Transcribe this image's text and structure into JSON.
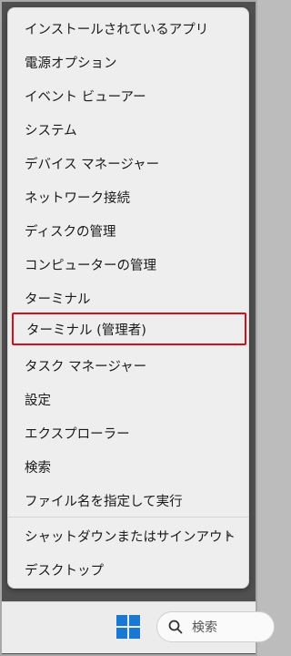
{
  "menu": {
    "items": [
      {
        "label": "インストールされているアプリ"
      },
      {
        "label": "電源オプション"
      },
      {
        "label": "イベント ビューアー"
      },
      {
        "label": "システム"
      },
      {
        "label": "デバイス マネージャー"
      },
      {
        "label": "ネットワーク接続"
      },
      {
        "label": "ディスクの管理"
      },
      {
        "label": "コンピューターの管理"
      },
      {
        "label": "ターミナル"
      },
      {
        "label": "ターミナル (管理者)"
      },
      {
        "label": "タスク マネージャー"
      },
      {
        "label": "設定"
      },
      {
        "label": "エクスプローラー"
      },
      {
        "label": "検索"
      },
      {
        "label": "ファイル名を指定して実行"
      },
      {
        "label": "シャットダウンまたはサインアウト"
      },
      {
        "label": "デスクトップ"
      }
    ],
    "submenu_indicator": "›",
    "highlighted_item": "ターミナル (管理者)",
    "highlight_color": "#d0101a"
  },
  "taskbar": {
    "start_icon": "windows-logo-icon",
    "start_color": "#1978d4",
    "search_icon": "search-icon",
    "search_label": "検索"
  }
}
